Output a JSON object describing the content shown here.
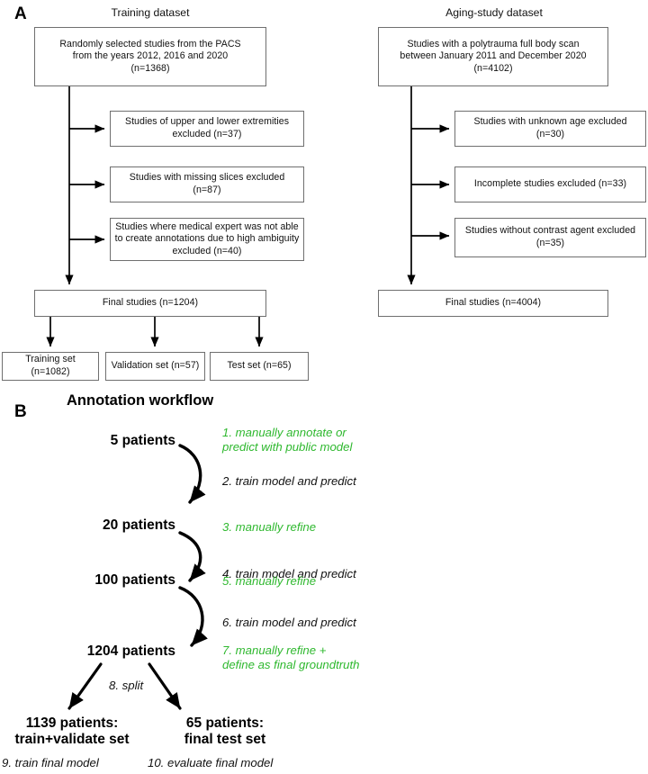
{
  "panels": {
    "a": {
      "letter": "A",
      "columns": [
        {
          "title": "Training dataset",
          "source_box": "Randomly selected studies from the PACS\nfrom the years 2012, 2016 and 2020\n(n=1368)",
          "exclusions": [
            "Studies of upper and lower extremities\nexcluded (n=37)",
            "Studies with missing slices excluded\n(n=87)",
            "Studies where medical expert was not able\nto create annotations due to high ambiguity\nexcluded  (n=40)"
          ],
          "final_box": "Final studies (n=1204)",
          "splits": [
            "Training set (n=1082)",
            "Validation set (n=57)",
            "Test set (n=65)"
          ]
        },
        {
          "title": "Aging-study dataset",
          "source_box": "Studies with a polytrauma full body scan\nbetween January 2011 and December 2020\n(n=4102)",
          "exclusions": [
            "Studies with unknown age excluded (n=30)",
            "Incomplete studies excluded (n=33)",
            "Studies without contrast agent excluded\n(n=35)"
          ],
          "final_box": "Final studies (n=4004)",
          "splits": []
        }
      ]
    },
    "b": {
      "letter": "B",
      "title": "Annotation workflow",
      "nodes": [
        "5 patients",
        "20 patients",
        "100 patients",
        "1204 patients",
        "1139 patients:\ntrain+validate set",
        "65 patients:\nfinal test set"
      ],
      "steps": [
        {
          "text": "1. manually annotate or\n    predict with public model",
          "green": true
        },
        {
          "text": "2. train model and predict",
          "green": false
        },
        {
          "text": "3. manually refine",
          "green": true
        },
        {
          "text": "4. train model and predict",
          "green": false
        },
        {
          "text": "5. manually refine",
          "green": true
        },
        {
          "text": "6. train model and predict",
          "green": false
        },
        {
          "text": "7. manually refine +\n    define as final groundtruth",
          "green": true
        },
        {
          "text": "8. split",
          "green": false
        },
        {
          "text": "9. train final model",
          "green": false
        },
        {
          "text": "10. evaluate final model",
          "green": false
        }
      ]
    }
  },
  "colors": {
    "green_accent": "#2eb82e",
    "box_border": "#6f6f6f",
    "arrow": "#000000",
    "text": "#111111",
    "background": "#ffffff"
  }
}
